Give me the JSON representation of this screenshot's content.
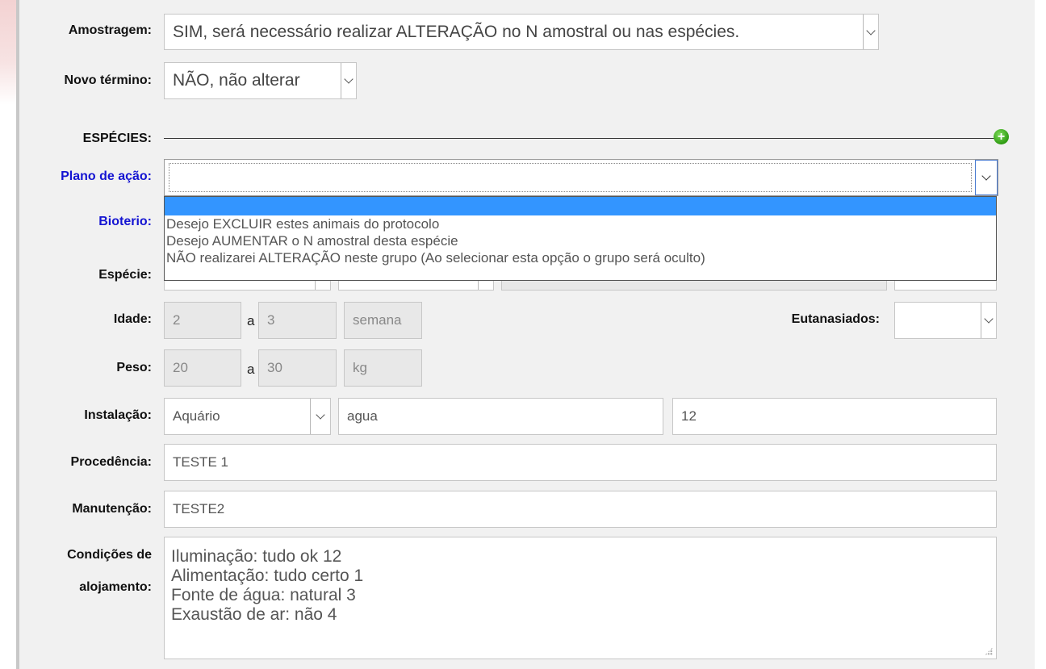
{
  "form": {
    "amostragem": {
      "label": "Amostragem:",
      "value": "SIM, será necessário realizar ALTERAÇÃO no N amostral ou nas espécies."
    },
    "novo_termino": {
      "label": "Novo término:",
      "value": "NÃO, não alterar"
    },
    "especies_section": {
      "label": "ESPÉCIES:",
      "add_icon": "plus-circle-icon",
      "add_icon_color": "#3aaa1c"
    },
    "plano_de_acao": {
      "label": "Plano de ação:",
      "value": "",
      "options": [
        "",
        "Desejo EXCLUIR estes animais do protocolo",
        "Desejo AUMENTAR o N amostral desta espécie",
        "NÃO realizarei ALTERAÇÃO neste grupo (Ao selecionar esta opção o grupo será oculto)"
      ],
      "highlight_color": "#3395ff"
    },
    "bioterio": {
      "label": "Bioterio:"
    },
    "especie": {
      "label": "Espécie:"
    },
    "idade": {
      "label": "Idade:",
      "from": "2",
      "sep": "a",
      "to": "3",
      "unit": "semana"
    },
    "eutanasiados": {
      "label": "Eutanasiados:",
      "value": ""
    },
    "peso": {
      "label": "Peso:",
      "from": "20",
      "sep": "a",
      "to": "30",
      "unit": "kg"
    },
    "instalacao": {
      "label": "Instalação:",
      "type": "Aquário",
      "desc": "agua",
      "qty": "12"
    },
    "procedencia": {
      "label": "Procedência:",
      "value": "TESTE 1"
    },
    "manutencao": {
      "label": "Manutenção:",
      "value": "TESTE2"
    },
    "condicoes": {
      "label_line1": "Condições de",
      "label_line2": "alojamento:",
      "lines": [
        "Iluminação: tudo ok 12",
        "Alimentação: tudo certo 1",
        "Fonte de água: natural 3",
        "Exaustão de ar: não 4"
      ]
    }
  },
  "colors": {
    "label_blue": "#1414d2",
    "panel_bg": "#f1f1f1"
  }
}
